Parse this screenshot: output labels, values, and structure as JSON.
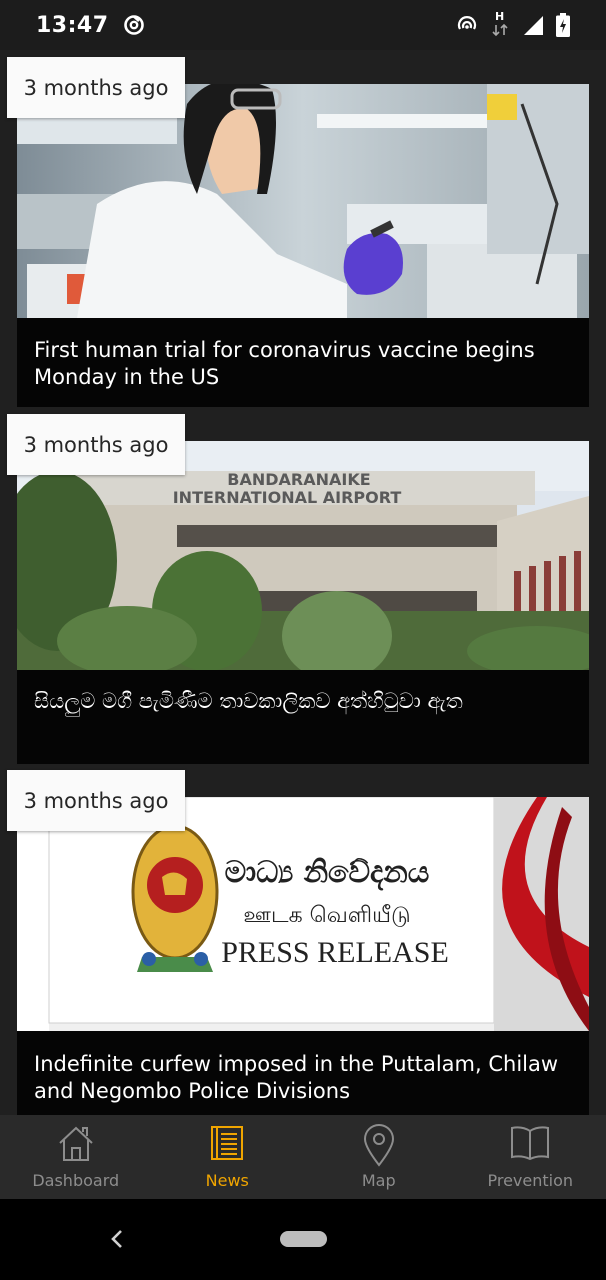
{
  "status_bar": {
    "time": "13:47",
    "network_label": "H"
  },
  "feed": {
    "items": [
      {
        "time_ago": "3 months ago",
        "title": "First human trial for coronavirus vaccine begins Monday in the US",
        "image": "lab-scientist-photo"
      },
      {
        "time_ago": "3 months ago",
        "title": "සියලුම මගී පැමිණීම තාවකාලිකව අත්හිටුවා ඇත",
        "image": "airport-building-photo",
        "sign_line1": "BANDARANAIKE",
        "sign_line2": "INTERNATIONAL AIRPORT"
      },
      {
        "time_ago": "3 months ago",
        "title": "Indefinite curfew imposed in the Puttalam, Chilaw and Negombo Police Divisions",
        "image": "press-release-graphic",
        "graphic_sinhala": "මාධ්‍ය නිවේදනය",
        "graphic_tamil": "ஊடக வெளியீடு",
        "graphic_english": "PRESS RELEASE"
      }
    ]
  },
  "bottom_nav": {
    "items": [
      {
        "label": "Dashboard",
        "icon": "home-icon"
      },
      {
        "label": "News",
        "icon": "news-icon"
      },
      {
        "label": "Map",
        "icon": "map-pin-icon"
      },
      {
        "label": "Prevention",
        "icon": "book-icon"
      }
    ],
    "active": "News"
  },
  "colors": {
    "accent": "#f0a500",
    "inactive": "#8d8d8d",
    "background": "#202020"
  }
}
